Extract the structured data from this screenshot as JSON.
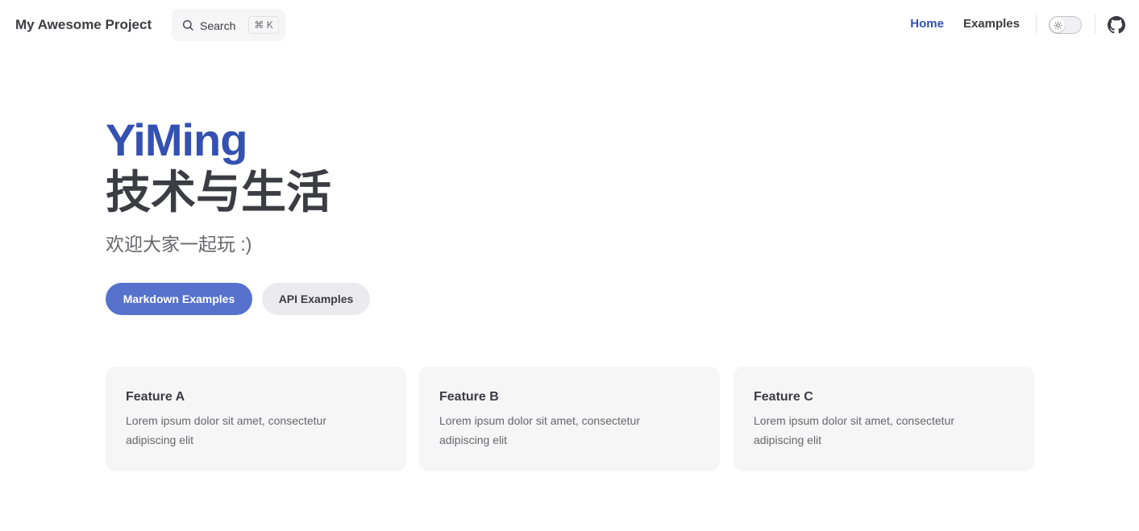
{
  "nav": {
    "site_title": "My Awesome Project",
    "search": {
      "label": "Search",
      "shortcut": "⌘ K"
    },
    "links": [
      {
        "label": "Home",
        "active": true
      },
      {
        "label": "Examples",
        "active": false
      }
    ],
    "appearance_icon": "sun-icon",
    "social_icon": "github-icon"
  },
  "hero": {
    "name": "YiMing",
    "text": "技术与生活",
    "tagline": "欢迎大家一起玩 :)",
    "actions": [
      {
        "label": "Markdown Examples",
        "theme": "brand"
      },
      {
        "label": "API Examples",
        "theme": "alt"
      }
    ]
  },
  "features": [
    {
      "title": "Feature A",
      "details": "Lorem ipsum dolor sit amet, consectetur adipiscing elit"
    },
    {
      "title": "Feature B",
      "details": "Lorem ipsum dolor sit amet, consectetur adipiscing elit"
    },
    {
      "title": "Feature C",
      "details": "Lorem ipsum dolor sit amet, consectetur adipiscing elit"
    }
  ],
  "colors": {
    "brand": "#3451b2",
    "brand_button": "#5672cd",
    "text": "#3c3c43",
    "muted_text": "#67676c",
    "card_bg": "#f6f6f7"
  }
}
